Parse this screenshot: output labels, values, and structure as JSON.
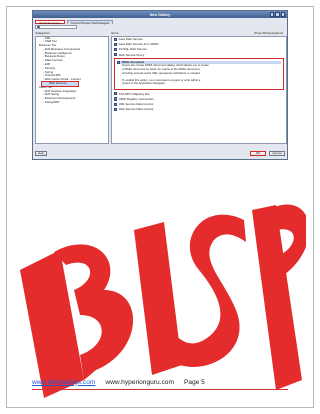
{
  "dialog": {
    "title": "New Gallery",
    "tabs": [
      "All Technologies",
      "Current Project Technologies"
    ],
    "search_placeholder": "",
    "columns": {
      "categories": "Categories:",
      "items": "Items:",
      "show_all": "Show All Descriptions"
    },
    "categories": [
      {
        "label": "- XML",
        "level": 2
      },
      {
        "label": "- XSM Tier",
        "level": 2
      },
      {
        "label": "Business Tier",
        "level": 1
      },
      {
        "label": "- ADF Business Components",
        "level": 2
      },
      {
        "label": "- Business Intelligence",
        "level": 2
      },
      {
        "label": "- Business Rules",
        "level": 2
      },
      {
        "label": "- Data Controls",
        "level": 2
      },
      {
        "label": "- EJB",
        "level": 2
      },
      {
        "label": "- Security",
        "level": 2
      },
      {
        "label": "- Spring",
        "level": 2
      },
      {
        "label": "- TopLink/JPA",
        "level": 2
      },
      {
        "label": "- Web Cache Portal - Content",
        "level": 2
      },
      {
        "label": "Web Services",
        "level": 2,
        "selected": true
      },
      {
        "label": "Client Tier",
        "level": 1
      },
      {
        "label": "- ADF Desktop Integration",
        "level": 2
      },
      {
        "label": "- ADF Swing",
        "level": 2
      },
      {
        "label": "- Extension Development",
        "level": 2
      },
      {
        "label": "- Swing/AWT",
        "level": 2
      }
    ],
    "items_before": [
      "Java Web Service",
      "Java Web Service from WSDL",
      "PL/SQL Web Service",
      "Web Service Proxy"
    ],
    "description": {
      "title": "WSDL Document",
      "text": [
        "Opens the Create WSDL Document dialog, which allows you to create",
        "a WSDL document by hand. An outline of the WSDL document,",
        "including several useful XML namespace definitions, is created.",
        "",
        "To enable this option, you must select a project or a file within a",
        "project in the Application Navigator."
      ]
    },
    "items_after": [
      "JAX-RPC Mapping File",
      "UDDI Registry Connection",
      "URL Service Data Control",
      "Web Service Data Control"
    ],
    "buttons": {
      "help": "Help",
      "ok": "OK",
      "cancel": "Cancel"
    }
  },
  "footer": {
    "link": "www.bisptrainigs.com",
    "site": "www.hyperionguru.com",
    "page": "Page 5"
  },
  "colors": {
    "watermark": "#e21b1b",
    "highlight": "#d12a2a",
    "link": "#1f5bd6"
  }
}
